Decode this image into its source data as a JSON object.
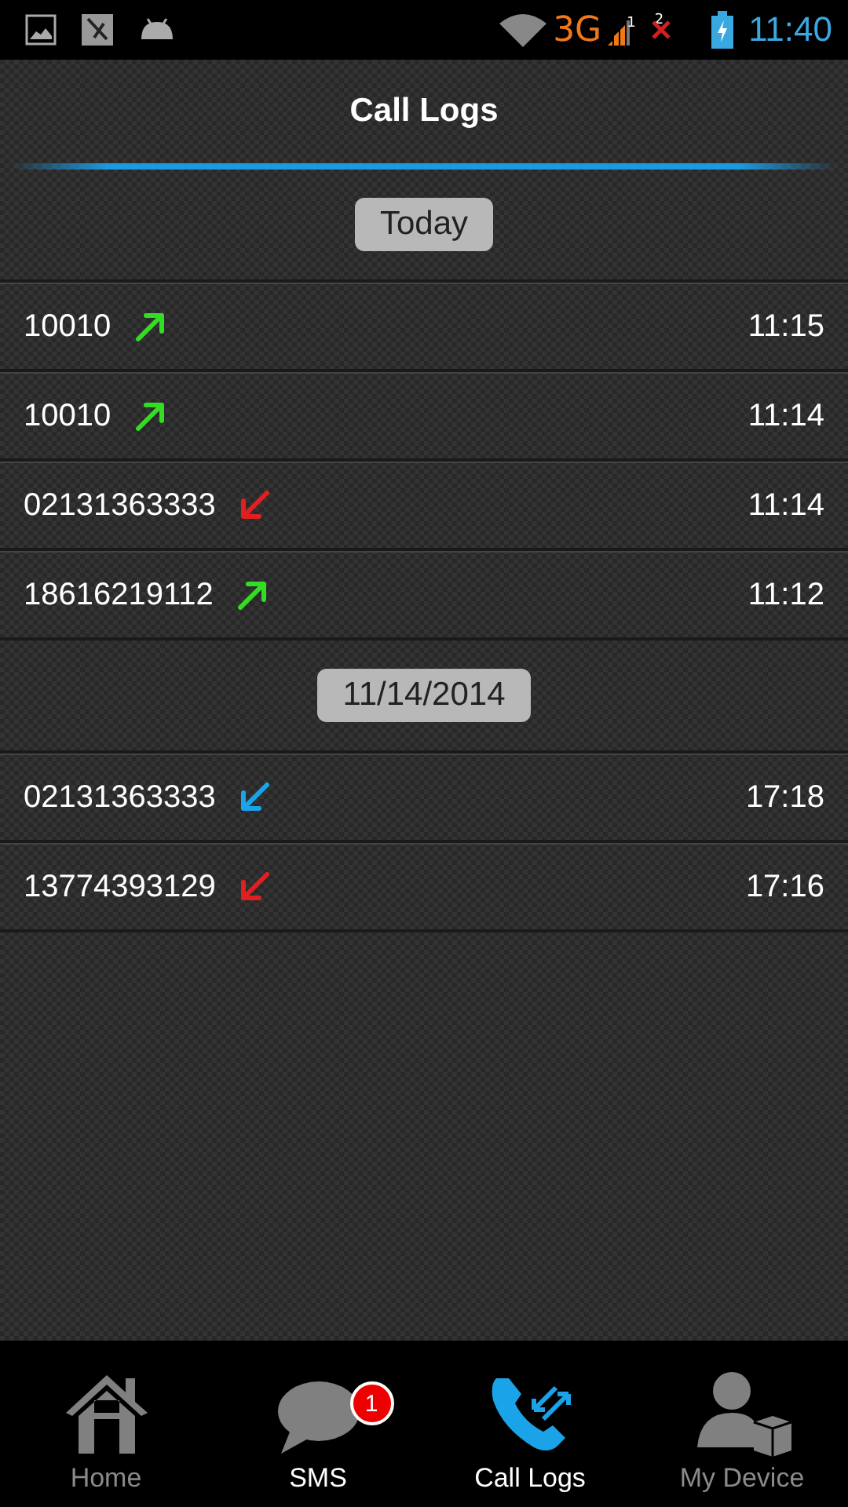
{
  "status_bar": {
    "network": "3G",
    "sim_1": "1",
    "sim_2": "2",
    "time": "11:40"
  },
  "header": {
    "title": "Call Logs"
  },
  "groups": [
    {
      "date": "Today",
      "calls": [
        {
          "number": "10010",
          "kind": "outgoing",
          "time": "11:15"
        },
        {
          "number": "10010",
          "kind": "outgoing",
          "time": "11:14"
        },
        {
          "number": "02131363333",
          "kind": "missed",
          "time": "11:14"
        },
        {
          "number": "18616219112",
          "kind": "outgoing",
          "time": "11:12"
        }
      ]
    },
    {
      "date": "11/14/2014",
      "calls": [
        {
          "number": "02131363333",
          "kind": "incoming",
          "time": "17:18"
        },
        {
          "number": "13774393129",
          "kind": "missed",
          "time": "17:16"
        }
      ]
    }
  ],
  "nav": [
    {
      "label": "Home",
      "kind": "home",
      "selected": false,
      "highlighted": false
    },
    {
      "label": "SMS",
      "kind": "sms",
      "selected": false,
      "highlighted": true,
      "badge": "1"
    },
    {
      "label": "Call Logs",
      "kind": "calls",
      "selected": true,
      "highlighted": true
    },
    {
      "label": "My Device",
      "kind": "device",
      "selected": false,
      "highlighted": false
    }
  ]
}
